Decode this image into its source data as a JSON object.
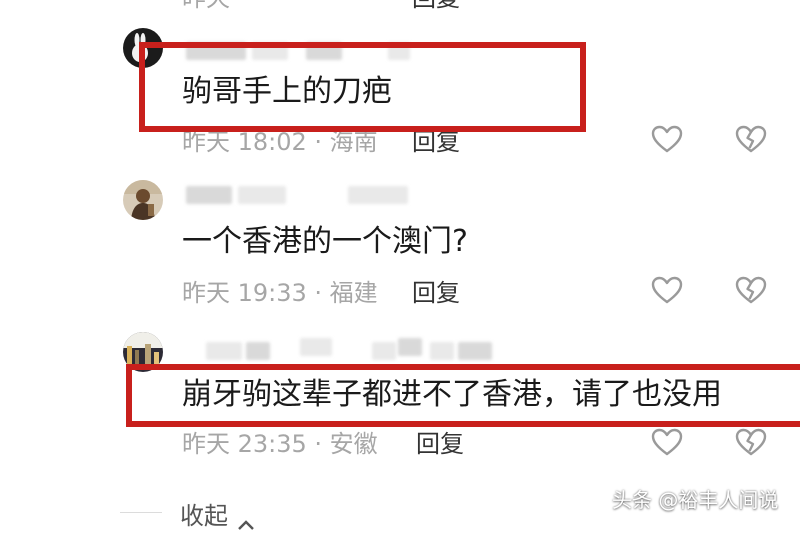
{
  "top_partial": {
    "meta": "昨天 ·",
    "reply_label": "回复"
  },
  "comments": [
    {
      "text": "驹哥手上的刀疤",
      "time_location": "昨天 18:02 · 海南",
      "reply_label": "回复",
      "highlighted": true
    },
    {
      "text": "一个香港的一个澳门?",
      "time_location": "昨天 19:33 · 福建",
      "reply_label": "回复",
      "highlighted": false
    },
    {
      "text": "崩牙驹这辈子都进不了香港，请了也没用",
      "time_location": "昨天 23:35 · 安徽",
      "reply_label": "回复",
      "highlighted": true
    }
  ],
  "footer": {
    "collapse_label": "收起",
    "collapse_icon": "chevron-up-icon"
  },
  "watermark": "头条 @裕丰人间说",
  "icons": {
    "like": "heart-icon",
    "dislike": "broken-heart-icon"
  },
  "colors": {
    "highlight_border": "#c8201c",
    "meta_text": "#a6a6a6",
    "icon_stroke": "#9a9a9a"
  }
}
